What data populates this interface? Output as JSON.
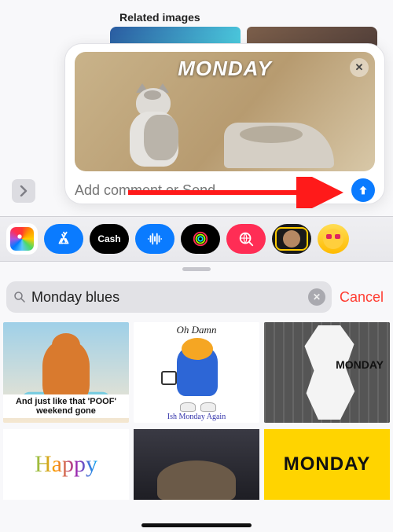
{
  "header": {
    "related_label": "Related images"
  },
  "compose": {
    "preview_caption": "MONDAY",
    "close_icon": "x",
    "input_placeholder": "Add comment or Send",
    "input_value": "",
    "send_icon": "arrow-up"
  },
  "expand_chevron": "chevron-right",
  "annotation_arrow": "arrow-right-red",
  "app_strip": {
    "items": [
      {
        "id": "photos",
        "name": "Photos"
      },
      {
        "id": "appstore",
        "name": "App Store"
      },
      {
        "id": "cash",
        "name": "Apple Cash",
        "label": "Cash",
        "apple_glyph": ""
      },
      {
        "id": "audio",
        "name": "Audio Messages"
      },
      {
        "id": "fitness",
        "name": "Fitness"
      },
      {
        "id": "gifsearch",
        "name": "GIF Search"
      },
      {
        "id": "memoji",
        "name": "Memoji"
      },
      {
        "id": "emoji",
        "name": "Emoji"
      }
    ]
  },
  "search": {
    "mag_icon": "magnifying-glass",
    "value": "Monday blues",
    "clear_icon": "x",
    "cancel_label": "Cancel"
  },
  "results_row1": [
    {
      "id": "poof",
      "caption": "And just like that 'POOF' weekend gone"
    },
    {
      "id": "garfield",
      "title": "Oh Damn",
      "subtitle": "Ish Monday Again"
    },
    {
      "id": "torn",
      "label": "MONDAY"
    }
  ],
  "results_row2": [
    {
      "id": "happy",
      "text": "Happy"
    },
    {
      "id": "dark",
      "text": ""
    },
    {
      "id": "yellow",
      "text": "MONDAY"
    }
  ],
  "home_indicator": true
}
